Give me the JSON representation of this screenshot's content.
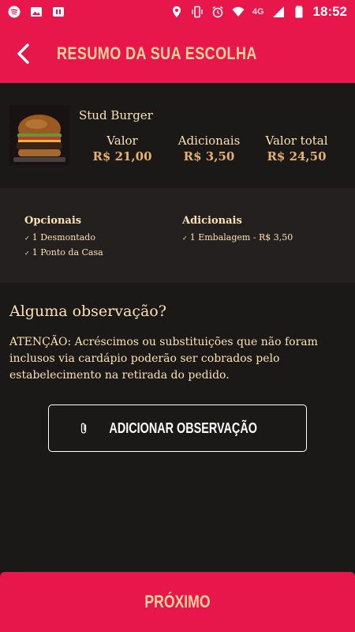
{
  "status_bar": {
    "time": "18:52",
    "network": "4G",
    "left_icons": [
      "spotify-icon",
      "image-icon",
      "app-icon"
    ],
    "right_icons": [
      "location-icon",
      "vibrate-icon",
      "alarm-icon",
      "wifi-icon",
      "signal-icon",
      "battery-icon"
    ]
  },
  "header": {
    "title": "RESUMO DA SUA ESCOLHA",
    "back_icon": "chevron-left-icon"
  },
  "product": {
    "name": "Stud Burger",
    "columns": [
      {
        "label": "Valor",
        "value": "R$ 21,00"
      },
      {
        "label": "Adicionais",
        "value": "R$ 3,50"
      },
      {
        "label": "Valor total",
        "value": "R$ 24,50"
      }
    ]
  },
  "extras": {
    "opcionais": {
      "title": "Opcionais",
      "items": [
        "1 Desmontado",
        "1 Ponto da Casa"
      ]
    },
    "adicionais": {
      "title": "Adicionais",
      "items": [
        "1 Embalagem - R$ 3,50"
      ]
    },
    "check_mark": "✓"
  },
  "observation": {
    "title": "Alguma observação?",
    "warning": "ATENÇÃO: Acréscimos ou substituições que não foram inclusos via cardápio poderão ser cobrados pelo estabelecimento na retirada do pedido.",
    "button_label": "ADICIONAR OBSERVAÇÃO",
    "button_icon": "paperclip-icon"
  },
  "footer": {
    "next_label": "PRÓXIMO"
  },
  "colors": {
    "brand": "#e8174b",
    "background": "#1b1818",
    "panel": "#242020",
    "cream": "#fbe2b0",
    "gold": "#e5b26b"
  }
}
